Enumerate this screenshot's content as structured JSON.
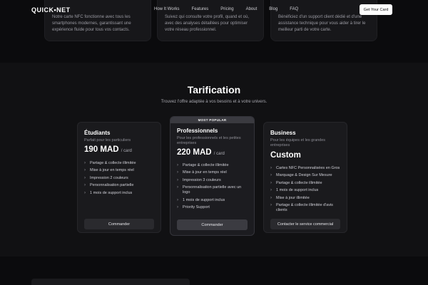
{
  "nav": {
    "logo": "QUICK•NET",
    "links": [
      "How It Works",
      "Features",
      "Pricing",
      "About",
      "Blog",
      "FAQ"
    ],
    "cta": "Get Your Card"
  },
  "features": [
    "Notre carte NFC fonctionne avec tous les smartphones modernes, garantissant une expérience fluide pour tous vos contacts.",
    "Suivez qui consulte votre profil, quand et où, avec des analyses détaillées pour optimiser votre réseau professionnel.",
    "Bénéficiez d'un support client dédié et d'une assistance technique pour vous aider à tirer le meilleur parti de votre carte."
  ],
  "pricing": {
    "title": "Tarification",
    "subtitle": "Trouvez l'offre adaptée à vos besoins et à votre univers.",
    "plans": [
      {
        "name": "Étudiants",
        "desc": "Parfait pour les particuliers",
        "price": "190 MAD",
        "unit": "/ card",
        "features": [
          "Partage & collecte illimitée",
          "Mise à jour en temps réel",
          "Impression 2 couleurs",
          "Personnalisation partielle",
          "1 mois de support inclus"
        ],
        "button": "Commander"
      },
      {
        "badge": "MOST POPULAR",
        "name": "Professionnels",
        "desc": "Pour les professionnels et les petites entreprises",
        "price": "220 MAD",
        "unit": "/ card",
        "features": [
          "Partage & collecte illimitée",
          "Mise à jour en temps réel",
          "Impression 3 couleurs",
          "Personnalisation partielle avec un logo",
          "1 mois de support inclus",
          "Priority Support"
        ],
        "button": "Commander"
      },
      {
        "name": "Business",
        "desc": "Pour les équipes et les grandes entreprises",
        "price": "Custom",
        "features": [
          "Cartes NFC Personnalisées en Gros",
          "Marquage & Design Sur Mesure",
          "Partage & collecte illimitée",
          "1 mois de support inclus",
          "Mise à jour illimitée",
          "Partage & collecte illimitée d'avis clients"
        ],
        "button": "Contacter le service commercial"
      }
    ]
  }
}
